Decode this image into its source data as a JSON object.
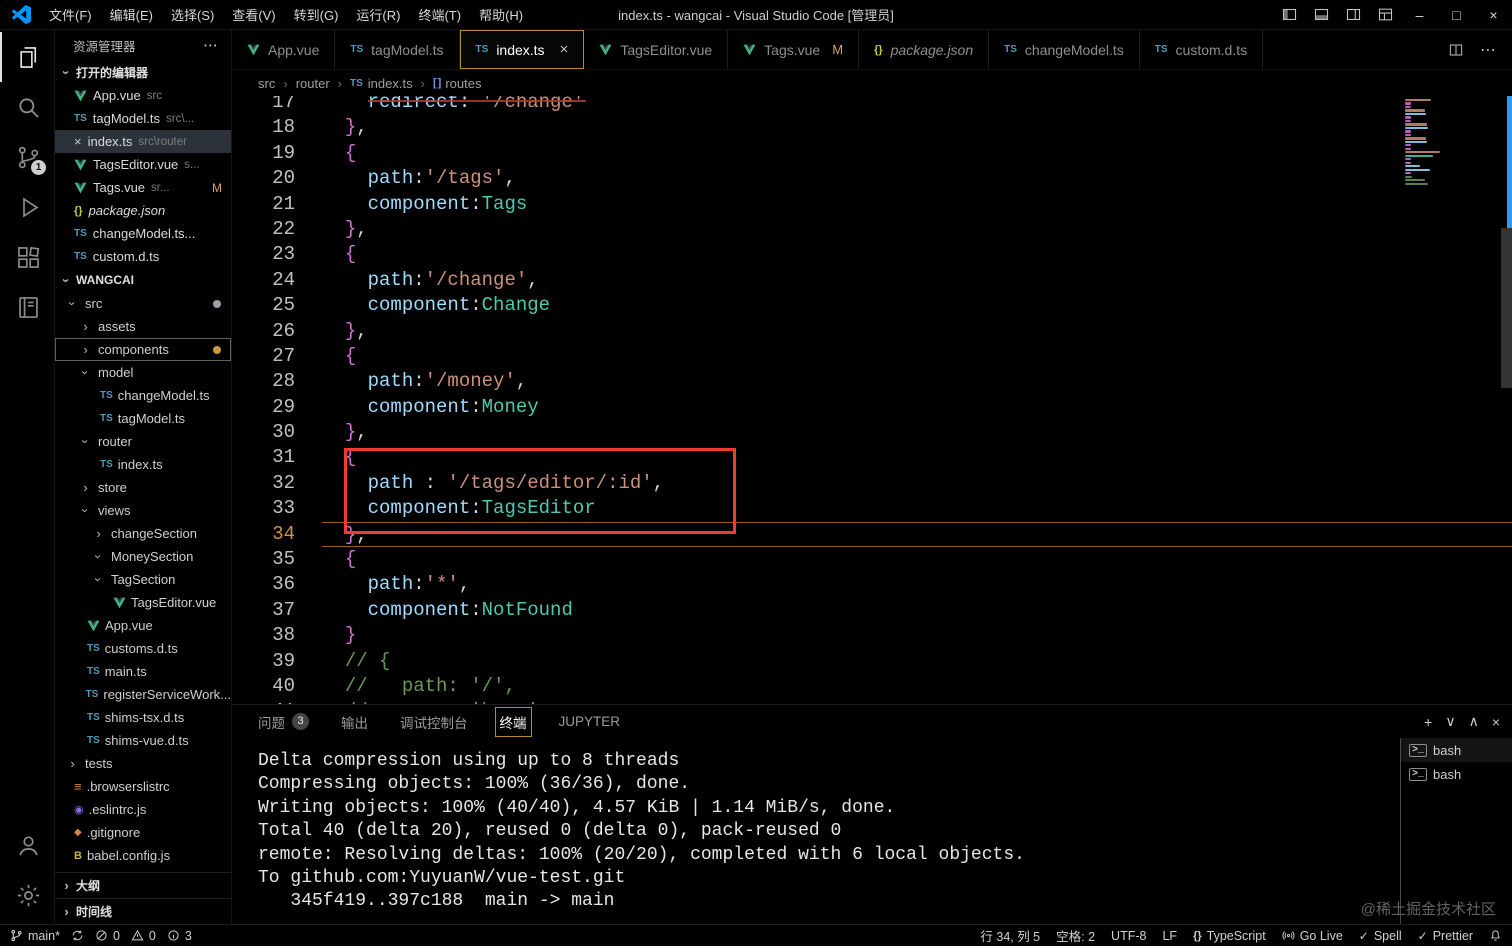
{
  "window": {
    "title": "index.ts - wangcai - Visual Studio Code [管理员]"
  },
  "menu_bar": [
    {
      "key": "file",
      "label": "文件(F)"
    },
    {
      "key": "edit",
      "label": "编辑(E)"
    },
    {
      "key": "selection",
      "label": "选择(S)"
    },
    {
      "key": "view",
      "label": "查看(V)"
    },
    {
      "key": "goto",
      "label": "转到(G)"
    },
    {
      "key": "run",
      "label": "运行(R)"
    },
    {
      "key": "terminal",
      "label": "终端(T)"
    },
    {
      "key": "help",
      "label": "帮助(H)"
    }
  ],
  "title_bar_controls": {
    "layout_icons": [
      "layout-sidebar",
      "layout-panel",
      "layout-secondary",
      "layout-custom"
    ],
    "minimize": "–",
    "maximize": "□",
    "close": "×"
  },
  "activity_bar": {
    "top": [
      {
        "name": "explorer",
        "active": true
      },
      {
        "name": "search"
      },
      {
        "name": "source-control",
        "badge": "1"
      },
      {
        "name": "run-debug"
      },
      {
        "name": "extensions"
      },
      {
        "name": "notebook"
      }
    ],
    "bottom": [
      {
        "name": "account"
      },
      {
        "name": "settings"
      }
    ]
  },
  "sidebar": {
    "title": "资源管理器",
    "open_editors_label": "打开的编辑器",
    "open_editors": [
      {
        "icon": "vue",
        "name": "App.vue",
        "detail": "src"
      },
      {
        "icon": "ts",
        "name": "tagModel.ts",
        "detail": "src\\..."
      },
      {
        "icon": "close",
        "name": "index.ts",
        "detail": "src\\router",
        "selected": true
      },
      {
        "icon": "vue",
        "name": "TagsEditor.vue",
        "detail": "s..."
      },
      {
        "icon": "vue",
        "name": "Tags.vue",
        "detail": "sr...",
        "badge": "M"
      },
      {
        "icon": "json",
        "name": "package.json",
        "detail": "",
        "italic": true
      },
      {
        "icon": "ts",
        "name": "changeModel.ts...",
        "detail": ""
      },
      {
        "icon": "ts",
        "name": "custom.d.ts",
        "detail": ""
      }
    ],
    "project_label": "WANGCAI",
    "tree": [
      {
        "name": "src",
        "kind": "folder",
        "expanded": true,
        "level": 0,
        "dot": "#9da0a6"
      },
      {
        "name": "assets",
        "kind": "folder",
        "level": 1
      },
      {
        "name": "components",
        "kind": "folder",
        "level": 1,
        "focused": true,
        "dot": "#c79b3c"
      },
      {
        "name": "model",
        "kind": "folder",
        "expanded": true,
        "level": 1
      },
      {
        "name": "changeModel.ts",
        "kind": "ts",
        "level": 2
      },
      {
        "name": "tagModel.ts",
        "kind": "ts",
        "level": 2
      },
      {
        "name": "router",
        "kind": "folder",
        "expanded": true,
        "level": 1
      },
      {
        "name": "index.ts",
        "kind": "ts",
        "level": 2
      },
      {
        "name": "store",
        "kind": "folder",
        "level": 1
      },
      {
        "name": "views",
        "kind": "folder",
        "expanded": true,
        "level": 1
      },
      {
        "name": "changeSection",
        "kind": "folder",
        "level": 2
      },
      {
        "name": "MoneySection",
        "kind": "folder",
        "expanded": true,
        "level": 2
      },
      {
        "name": "TagSection",
        "kind": "folder",
        "expanded": true,
        "level": 2
      },
      {
        "name": "TagsEditor.vue",
        "kind": "vue",
        "level": 3
      },
      {
        "name": "App.vue",
        "kind": "vue",
        "level": 1
      },
      {
        "name": "customs.d.ts",
        "kind": "ts",
        "level": 1
      },
      {
        "name": "main.ts",
        "kind": "ts",
        "level": 1
      },
      {
        "name": "registerServiceWork...",
        "kind": "ts",
        "level": 1
      },
      {
        "name": "shims-tsx.d.ts",
        "kind": "ts",
        "level": 1
      },
      {
        "name": "shims-vue.d.ts",
        "kind": "ts",
        "level": 1
      },
      {
        "name": "tests",
        "kind": "folder",
        "level": 0
      },
      {
        "name": ".browserslistrc",
        "kind": "config",
        "level": 0
      },
      {
        "name": ".eslintrc.js",
        "kind": "eslint",
        "level": 0
      },
      {
        "name": ".gitignore",
        "kind": "git",
        "level": 0
      },
      {
        "name": "babel.config.js",
        "kind": "babel",
        "level": 0
      }
    ],
    "outline_label": "大纲",
    "timeline_label": "时间线"
  },
  "editor": {
    "tabs": [
      {
        "icon": "vue",
        "label": "App.vue"
      },
      {
        "icon": "ts",
        "label": "tagModel.ts"
      },
      {
        "icon": "ts",
        "label": "index.ts",
        "active": true,
        "close": true
      },
      {
        "icon": "vue",
        "label": "TagsEditor.vue"
      },
      {
        "icon": "vue",
        "label": "Tags.vue",
        "badge": "M"
      },
      {
        "icon": "json",
        "label": "package.json",
        "italic": true
      },
      {
        "icon": "ts",
        "label": "changeModel.ts"
      },
      {
        "icon": "ts",
        "label": "custom.d.ts"
      }
    ],
    "breadcrumb": [
      {
        "label": "src"
      },
      {
        "label": "router"
      },
      {
        "label": "index.ts",
        "icon": "ts"
      },
      {
        "label": "routes",
        "icon": "symbol-array"
      }
    ],
    "current_line": 34,
    "lines": [
      {
        "n": 17,
        "tk": [
          [
            "    ",
            ""
          ],
          [
            "redirect",
            "p"
          ],
          [
            ": ",
            ""
          ],
          [
            "'/change'",
            "s"
          ]
        ]
      },
      {
        "n": 18,
        "tk": [
          [
            "  ",
            ""
          ],
          [
            "}",
            "b"
          ],
          [
            ",",
            ""
          ]
        ]
      },
      {
        "n": 19,
        "tk": [
          [
            "  ",
            ""
          ],
          [
            "{",
            "b"
          ]
        ]
      },
      {
        "n": 20,
        "tk": [
          [
            "    ",
            ""
          ],
          [
            "path",
            "p"
          ],
          [
            ":",
            ""
          ],
          [
            "'/tags'",
            "s"
          ],
          [
            ",",
            ""
          ]
        ]
      },
      {
        "n": 21,
        "tk": [
          [
            "    ",
            ""
          ],
          [
            "component",
            "p"
          ],
          [
            ":",
            ""
          ],
          [
            "Tags",
            "t"
          ]
        ]
      },
      {
        "n": 22,
        "tk": [
          [
            "  ",
            ""
          ],
          [
            "}",
            "b"
          ],
          [
            ",",
            ""
          ]
        ]
      },
      {
        "n": 23,
        "tk": [
          [
            "  ",
            ""
          ],
          [
            "{",
            "b"
          ]
        ]
      },
      {
        "n": 24,
        "tk": [
          [
            "    ",
            ""
          ],
          [
            "path",
            "p"
          ],
          [
            ":",
            ""
          ],
          [
            "'/change'",
            "s"
          ],
          [
            ",",
            ""
          ]
        ]
      },
      {
        "n": 25,
        "tk": [
          [
            "    ",
            ""
          ],
          [
            "component",
            "p"
          ],
          [
            ":",
            ""
          ],
          [
            "Change",
            "t"
          ]
        ]
      },
      {
        "n": 26,
        "tk": [
          [
            "  ",
            ""
          ],
          [
            "}",
            "b"
          ],
          [
            ",",
            ""
          ]
        ]
      },
      {
        "n": 27,
        "tk": [
          [
            "  ",
            ""
          ],
          [
            "{",
            "b"
          ]
        ]
      },
      {
        "n": 28,
        "tk": [
          [
            "    ",
            ""
          ],
          [
            "path",
            "p"
          ],
          [
            ":",
            ""
          ],
          [
            "'/money'",
            "s"
          ],
          [
            ",",
            ""
          ]
        ]
      },
      {
        "n": 29,
        "tk": [
          [
            "    ",
            ""
          ],
          [
            "component",
            "p"
          ],
          [
            ":",
            ""
          ],
          [
            "Money",
            "t"
          ]
        ]
      },
      {
        "n": 30,
        "tk": [
          [
            "  ",
            ""
          ],
          [
            "}",
            "b"
          ],
          [
            ",",
            ""
          ]
        ]
      },
      {
        "n": 31,
        "tk": [
          [
            "  ",
            ""
          ],
          [
            "{",
            "b"
          ]
        ]
      },
      {
        "n": 32,
        "tk": [
          [
            "    ",
            ""
          ],
          [
            "path",
            "p"
          ],
          [
            " : ",
            ""
          ],
          [
            "'/tags/editor/:id'",
            "s"
          ],
          [
            ",",
            ""
          ]
        ]
      },
      {
        "n": 33,
        "tk": [
          [
            "    ",
            ""
          ],
          [
            "component",
            "p"
          ],
          [
            ":",
            ""
          ],
          [
            "TagsEditor",
            "t"
          ]
        ]
      },
      {
        "n": 34,
        "tk": [
          [
            "  ",
            ""
          ],
          [
            "}",
            "b"
          ],
          [
            ",",
            ""
          ]
        ]
      },
      {
        "n": 35,
        "tk": [
          [
            "  ",
            ""
          ],
          [
            "{",
            "b"
          ]
        ]
      },
      {
        "n": 36,
        "tk": [
          [
            "    ",
            ""
          ],
          [
            "path",
            "p"
          ],
          [
            ":",
            ""
          ],
          [
            "'*'",
            "s"
          ],
          [
            ",",
            ""
          ]
        ]
      },
      {
        "n": 37,
        "tk": [
          [
            "    ",
            ""
          ],
          [
            "component",
            "p"
          ],
          [
            ":",
            ""
          ],
          [
            "NotFound",
            "t"
          ]
        ]
      },
      {
        "n": 38,
        "tk": [
          [
            "  ",
            ""
          ],
          [
            "}",
            "b"
          ]
        ]
      },
      {
        "n": 39,
        "tk": [
          [
            "  ",
            ""
          ],
          [
            "// {",
            "c"
          ]
        ]
      },
      {
        "n": 40,
        "tk": [
          [
            "  ",
            ""
          ],
          [
            "//   path: '/',",
            "c"
          ]
        ]
      },
      {
        "n": 41,
        "tk": [
          [
            "  ",
            ""
          ],
          [
            "//   name: 'home',",
            "c"
          ]
        ]
      }
    ]
  },
  "panel": {
    "tabs": [
      {
        "key": "problems",
        "label": "问题",
        "badge": "3"
      },
      {
        "key": "output",
        "label": "输出"
      },
      {
        "key": "debug-console",
        "label": "调试控制台"
      },
      {
        "key": "terminal",
        "label": "终端",
        "active": true
      },
      {
        "key": "jupyter",
        "label": "JUPYTER"
      }
    ],
    "actions": [
      {
        "key": "new-terminal",
        "glyph": "+"
      },
      {
        "key": "terminal-dropdown",
        "glyph": "∨"
      },
      {
        "key": "maximize-panel",
        "glyph": "∧"
      },
      {
        "key": "close-panel",
        "glyph": "×"
      }
    ],
    "terminal_lines": [
      "Delta compression using up to 8 threads",
      "Compressing objects: 100% (36/36), done.",
      "Writing objects: 100% (40/40), 4.57 KiB | 1.14 MiB/s, done.",
      "Total 40 (delta 20), reused 0 (delta 0), pack-reused 0",
      "remote: Resolving deltas: 100% (20/20), completed with 6 local objects.",
      "To github.com:YuyuanW/vue-test.git",
      "   345f419..397c188  main -> main"
    ],
    "terminals": [
      {
        "label": "bash",
        "selected": true
      },
      {
        "label": "bash"
      }
    ],
    "watermark": "@稀土掘金技术社区"
  },
  "status_bar": {
    "left": [
      {
        "key": "branch",
        "icon": "branch",
        "label": "main*"
      },
      {
        "key": "sync",
        "icon": "sync",
        "label": ""
      },
      {
        "key": "errors",
        "icon": "error",
        "label": "0"
      },
      {
        "key": "warnings",
        "icon": "warning",
        "label": "0"
      },
      {
        "key": "info",
        "icon": "info",
        "label": "3"
      }
    ],
    "right": [
      {
        "key": "cursor-position",
        "label": "行 34, 列 5"
      },
      {
        "key": "indentation",
        "label": "空格: 2"
      },
      {
        "key": "encoding",
        "label": "UTF-8"
      },
      {
        "key": "eol",
        "label": "LF"
      },
      {
        "key": "language-mode",
        "icon": "braces",
        "label": "TypeScript"
      },
      {
        "key": "go-live",
        "icon": "broadcast",
        "label": "Go Live"
      },
      {
        "key": "spell",
        "icon": "check",
        "label": "Spell"
      },
      {
        "key": "prettier",
        "icon": "check",
        "label": "Prettier"
      },
      {
        "key": "notifications",
        "icon": "bell",
        "label": ""
      }
    ]
  },
  "colors": {
    "accent_orange": "#b88a2b",
    "annotation_red": "#f03b30",
    "current_line_border": "#9a6304",
    "modified_badge": "#d7a35f",
    "string": "#ce9178",
    "property": "#9cdcfe",
    "type": "#4ec9b0",
    "brace": "#d670d6",
    "comment": "#6a9955"
  }
}
